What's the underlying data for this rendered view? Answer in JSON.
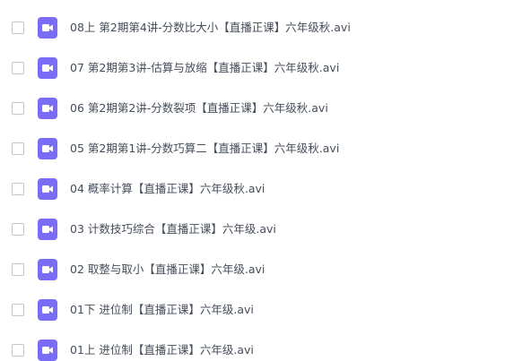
{
  "files": [
    {
      "name": "08上 第2期第4讲-分数比大小【直播正课】六年级秋.avi",
      "icon": "video-file-icon"
    },
    {
      "name": "07 第2期第3讲-估算与放缩【直播正课】六年级秋.avi",
      "icon": "video-file-icon"
    },
    {
      "name": "06 第2期第2讲-分数裂项【直播正课】六年级秋.avi",
      "icon": "video-file-icon"
    },
    {
      "name": "05 第2期第1讲-分数巧算二【直播正课】六年级秋.avi",
      "icon": "video-file-icon"
    },
    {
      "name": "04 概率计算【直播正课】六年级秋.avi",
      "icon": "video-file-icon"
    },
    {
      "name": "03 计数技巧综合【直播正课】六年级.avi",
      "icon": "video-file-icon"
    },
    {
      "name": "02 取整与取小【直播正课】六年级.avi",
      "icon": "video-file-icon"
    },
    {
      "name": "01下 进位制【直播正课】六年级.avi",
      "icon": "video-file-icon"
    },
    {
      "name": "01上 进位制【直播正课】六年级.avi",
      "icon": "video-file-icon"
    }
  ],
  "colors": {
    "icon_accent": "#7a6cf5",
    "text": "#454d5a",
    "checkbox_border": "#c6c6c6"
  }
}
